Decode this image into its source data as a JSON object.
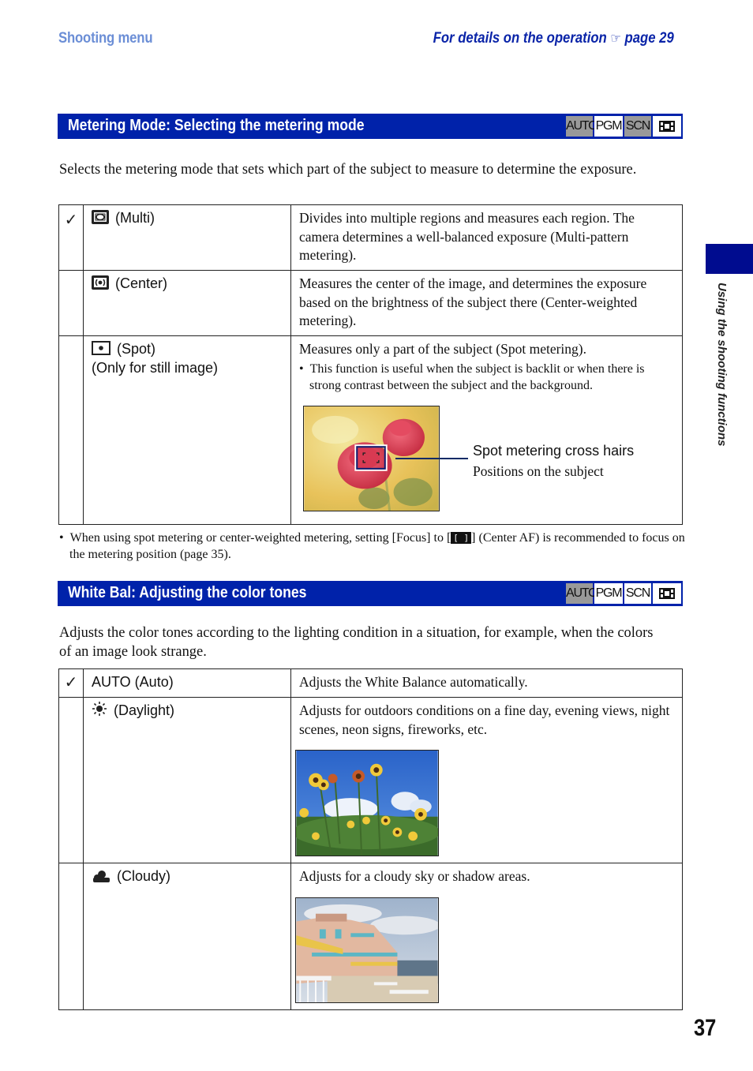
{
  "header": {
    "section": "Shooting menu",
    "reference_prefix": "For details on the operation",
    "reference_icon": "pointing-hand-icon",
    "reference_page": "page 29"
  },
  "side_tab": {
    "label": "Using the shooting functions",
    "color": "#000c8f"
  },
  "page_number": "37",
  "colors": {
    "section_bar": "#0022aa",
    "header_left": "#6b8ed6",
    "header_right": "#0a24a8",
    "badge_off": "#999999"
  },
  "metering": {
    "title": "Metering Mode: Selecting the metering mode",
    "badges": [
      {
        "label": "AUTO",
        "available": false
      },
      {
        "label": "PGM",
        "available": true
      },
      {
        "label": "SCN",
        "available": false
      },
      {
        "label": "movie-icon",
        "available": true
      }
    ],
    "intro": "Selects the metering mode that sets which part of the subject to measure to determine the exposure.",
    "rows": [
      {
        "default": true,
        "icon": "multi-metering-icon",
        "name": "(Multi)",
        "desc": "Divides into multiple regions and measures each region. The camera determines a well-balanced exposure (Multi-pattern metering)."
      },
      {
        "default": false,
        "icon": "center-metering-icon",
        "name": "(Center)",
        "desc": "Measures the center of the image, and determines the exposure based on the brightness of the subject there (Center-weighted metering)."
      },
      {
        "default": false,
        "icon": "spot-metering-icon",
        "name": "(Spot)",
        "name_line2": "(Only for still image)",
        "desc": "Measures only a part of the subject (Spot metering).",
        "bullet": "This function is useful when the subject is backlit or when there is strong contrast between the subject and the background.",
        "callout_title": "Spot metering cross hairs",
        "callout_sub": "Positions on the subject",
        "image": "rose-photo"
      }
    ],
    "note_before": "When using spot metering or center-weighted metering, setting [Focus] to [",
    "note_icon": "[ ]",
    "note_after": "] (Center AF) is recommended to focus on the metering position (page 35)."
  },
  "whitebal": {
    "title": "White Bal: Adjusting the color tones",
    "badges": [
      {
        "label": "AUTO",
        "available": false
      },
      {
        "label": "PGM",
        "available": true
      },
      {
        "label": "SCN",
        "available": true
      },
      {
        "label": "movie-icon",
        "available": true
      }
    ],
    "intro": "Adjusts the color tones according to the lighting condition in a situation, for example, when the colors of an image look strange.",
    "rows": [
      {
        "default": true,
        "name": "AUTO (Auto)",
        "desc": "Adjusts the White Balance automatically."
      },
      {
        "default": false,
        "icon": "daylight-icon",
        "name": "(Daylight)",
        "desc": "Adjusts for outdoors conditions on a fine day, evening views, night scenes, neon signs, fireworks, etc.",
        "image": "sunflowers-photo"
      },
      {
        "default": false,
        "icon": "cloudy-icon",
        "name": "(Cloudy)",
        "desc": "Adjusts for a cloudy sky or shadow areas.",
        "image": "seaside-hotel-photo"
      }
    ]
  }
}
